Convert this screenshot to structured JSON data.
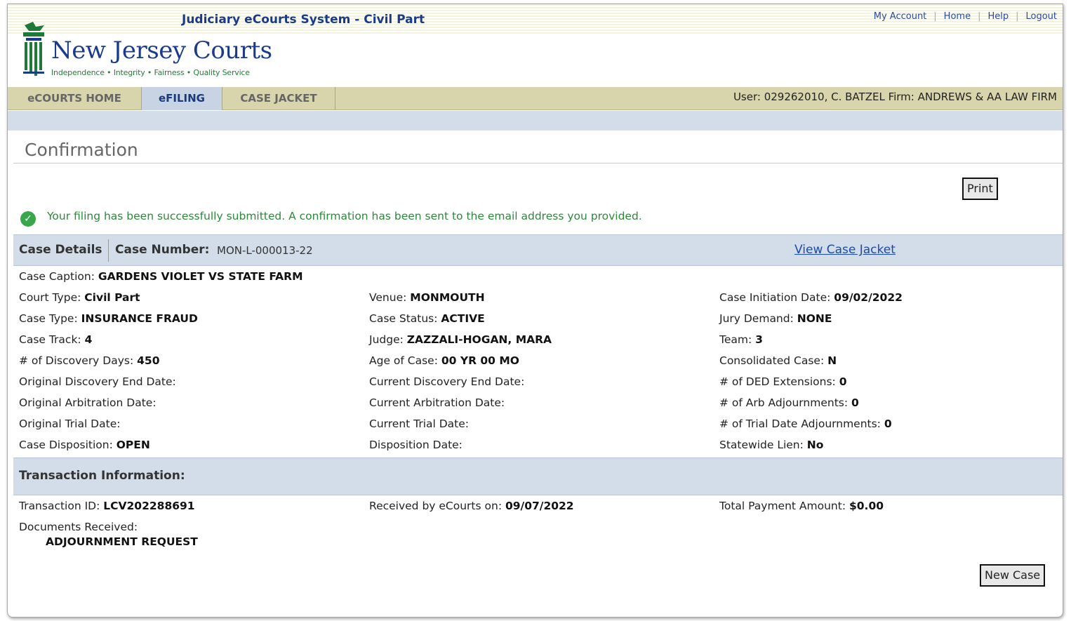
{
  "header": {
    "system_title": "Judiciary eCourts System - Civil Part",
    "links": [
      "My Account",
      "Home",
      "Help",
      "Logout"
    ],
    "logo_text": "New Jersey Courts",
    "logo_tagline": "Independence • Integrity • Fairness • Quality Service"
  },
  "nav": {
    "tabs": [
      {
        "label": "eCOURTS HOME",
        "active": false
      },
      {
        "label": "eFILING",
        "active": true
      },
      {
        "label": "CASE JACKET",
        "active": false
      }
    ],
    "user_info": "User: 029262010, C. BATZEL  Firm: ANDREWS & AA LAW FIRM"
  },
  "page": {
    "title": "Confirmation",
    "print_label": "Print",
    "success_message": "Your filing has been successfully submitted. A confirmation has been sent to the email address you provided.",
    "new_case_label": "New Case"
  },
  "case": {
    "details_label": "Case Details",
    "number_label": "Case Number:",
    "number_value": "MON-L-000013-22",
    "view_link": "View Case Jacket",
    "caption_label": "Case Caption:",
    "caption_value": "GARDENS VIOLET VS STATE FARM",
    "fields": [
      [
        {
          "label": "Court Type:",
          "value": "Civil Part"
        },
        {
          "label": "Venue:",
          "value": "MONMOUTH"
        },
        {
          "label": "Case Initiation Date:",
          "value": "09/02/2022"
        }
      ],
      [
        {
          "label": "Case Type:",
          "value": "INSURANCE FRAUD"
        },
        {
          "label": "Case Status:",
          "value": "ACTIVE"
        },
        {
          "label": "Jury Demand:",
          "value": "NONE"
        }
      ],
      [
        {
          "label": "Case Track:",
          "value": "4"
        },
        {
          "label": "Judge:",
          "value": "ZAZZALI-HOGAN, MARA"
        },
        {
          "label": "Team:",
          "value": "3"
        }
      ],
      [
        {
          "label": "# of Discovery Days:",
          "value": "450"
        },
        {
          "label": "Age of Case:",
          "value": "00 YR 00 MO"
        },
        {
          "label": "Consolidated Case:",
          "value": "N"
        }
      ],
      [
        {
          "label": "Original Discovery End Date:",
          "value": ""
        },
        {
          "label": "Current Discovery End Date:",
          "value": ""
        },
        {
          "label": "# of DED Extensions:",
          "value": "0"
        }
      ],
      [
        {
          "label": "Original Arbitration Date:",
          "value": ""
        },
        {
          "label": "Current Arbitration Date:",
          "value": ""
        },
        {
          "label": "# of Arb Adjournments:",
          "value": "0"
        }
      ],
      [
        {
          "label": "Original Trial Date:",
          "value": ""
        },
        {
          "label": "Current Trial Date:",
          "value": ""
        },
        {
          "label": "# of Trial Date Adjournments:",
          "value": "0"
        }
      ],
      [
        {
          "label": "Case Disposition:",
          "value": "OPEN"
        },
        {
          "label": "Disposition Date:",
          "value": ""
        },
        {
          "label": "Statewide Lien:",
          "value": "No"
        }
      ]
    ]
  },
  "transaction": {
    "heading": "Transaction Information:",
    "id_label": "Transaction ID:",
    "id_value": "LCV202288691",
    "received_label": "Received by eCourts on:",
    "received_value": "09/07/2022",
    "payment_label": "Total Payment Amount:",
    "payment_value": "$0.00",
    "documents_label": "Documents Received:",
    "documents": [
      "ADJOURNMENT REQUEST"
    ]
  },
  "colors": {
    "nav_bg": "#d8d4ac",
    "band_bg": "#d3dde9",
    "title_blue": "#1a3a8a",
    "success_green": "#2a8a3a"
  }
}
